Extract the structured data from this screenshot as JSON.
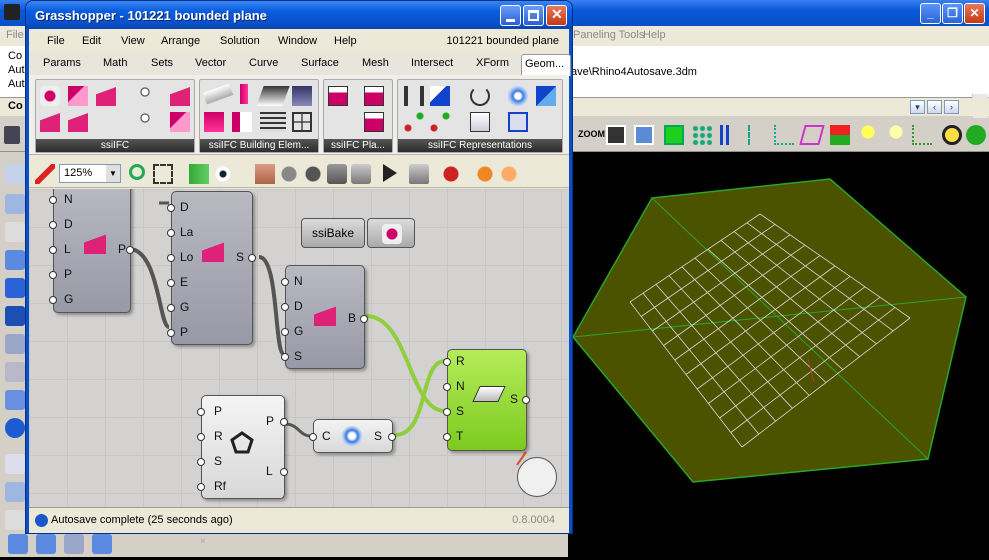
{
  "rhino": {
    "menus": [
      "File",
      "Paneling Tools",
      "Help"
    ],
    "cmd_lines": [
      "Co",
      "Aut",
      "Aut",
      "Co"
    ],
    "autosave_path": "ave\\Rhino4Autosave.3dm",
    "toolbar_zoom_label": "ZOOM"
  },
  "gh": {
    "title": "Grasshopper - 101221 bounded plane",
    "doc_label": "101221 bounded plane",
    "menus": [
      "File",
      "Edit",
      "View",
      "Arrange",
      "Solution",
      "Window",
      "Help"
    ],
    "tabs": [
      "Params",
      "Math",
      "Sets",
      "Vector",
      "Curve",
      "Surface",
      "Mesh",
      "Intersect",
      "XForm"
    ],
    "active_tab": "Geom...",
    "ribbon_groups": [
      "ssiIFC",
      "ssiIFC Building Elem...",
      "ssiIFC Pla...",
      "ssiIFC Representations"
    ],
    "zoom": "125%",
    "status": "Autosave complete (25 seconds ago)",
    "version": "0.8.0004",
    "colors": {
      "accent": "#0a4fc4",
      "canvas": "#d3d2d0",
      "green_component": "#8fd43a",
      "wire": "#555555",
      "wire_active": "#8fcf3f"
    }
  },
  "canvas": {
    "c1_ports": [
      "N",
      "D",
      "L",
      "P",
      "G"
    ],
    "c1_out": "P",
    "c2_ports": [
      "D",
      "La",
      "Lo",
      "E",
      "G",
      "P"
    ],
    "c2_out": "S",
    "c3_ports": [
      "N",
      "D",
      "G",
      "S"
    ],
    "c3_out": "B",
    "bake_label": "ssiBake",
    "poly_ports": [
      "P",
      "R",
      "S",
      "Rf"
    ],
    "poly_outs": [
      "P",
      "L"
    ],
    "circle_in": "C",
    "circle_out": "S",
    "green_ports": [
      "R",
      "N",
      "S",
      "T"
    ],
    "green_out": "S"
  }
}
